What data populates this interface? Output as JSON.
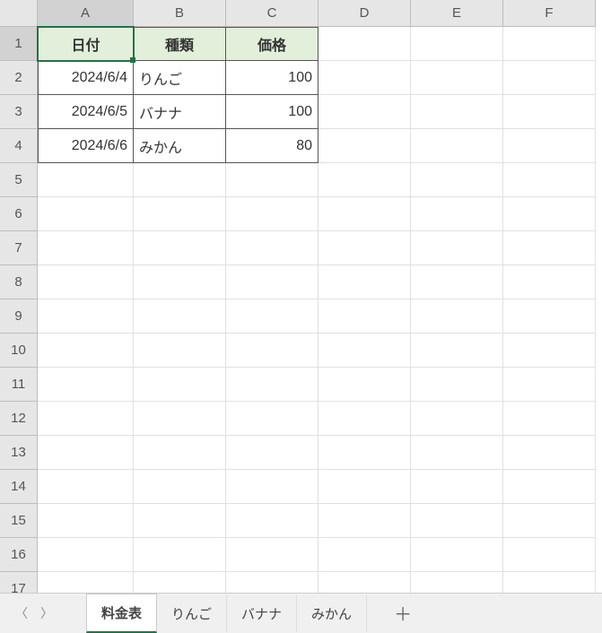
{
  "columns": [
    "A",
    "B",
    "C",
    "D",
    "E",
    "F"
  ],
  "rows": [
    "1",
    "2",
    "3",
    "4",
    "5",
    "6",
    "7",
    "8",
    "9",
    "10",
    "11",
    "12",
    "13",
    "14",
    "15",
    "16",
    "17"
  ],
  "table": {
    "headers": [
      "日付",
      "種類",
      "価格"
    ],
    "data": [
      {
        "date": "2024/6/4",
        "kind": "りんご",
        "price": "100"
      },
      {
        "date": "2024/6/5",
        "kind": "バナナ",
        "price": "100"
      },
      {
        "date": "2024/6/6",
        "kind": "みかん",
        "price": "80"
      }
    ]
  },
  "tabs": {
    "items": [
      "料金表",
      "りんご",
      "バナナ",
      "みかん"
    ],
    "active_index": 0
  },
  "chart_data": {
    "type": "table",
    "title": "料金表",
    "columns": [
      "日付",
      "種類",
      "価格"
    ],
    "rows": [
      [
        "2024/6/4",
        "りんご",
        100
      ],
      [
        "2024/6/5",
        "バナナ",
        100
      ],
      [
        "2024/6/6",
        "みかん",
        80
      ]
    ]
  }
}
